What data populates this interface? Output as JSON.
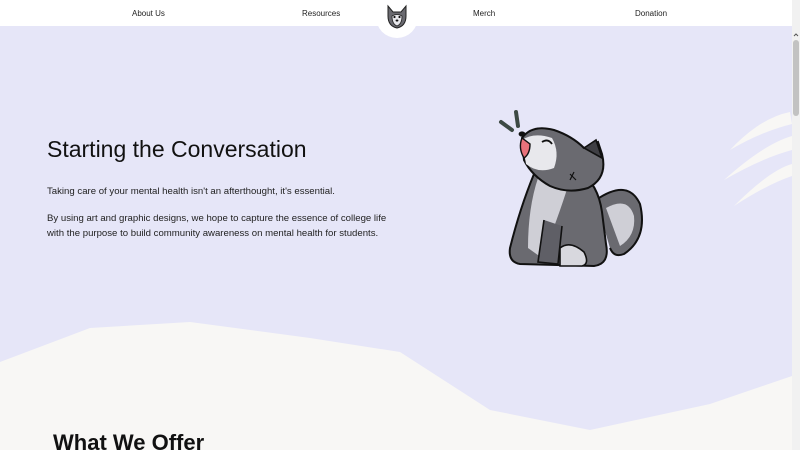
{
  "nav": {
    "items": [
      {
        "label": "About Us"
      },
      {
        "label": "Resources"
      },
      {
        "label": "Merch"
      },
      {
        "label": "Donation"
      }
    ],
    "logo_icon": "husky-logo-icon"
  },
  "hero": {
    "title": "Starting the Conversation",
    "paragraph_1": "Taking care of your mental health isn't an afterthought, it's essential.",
    "paragraph_2": "By using art and graphic designs, we hope to capture the essence of college life with the purpose to build community awareness on mental health for students.",
    "illustration": "howling-husky-icon",
    "decoration": "claw-marks-icon"
  },
  "section": {
    "title": "What We Offer"
  },
  "colors": {
    "hero_bg": "#e6e6f8",
    "ground": "#f8f7f5",
    "nav_bg": "#ffffff",
    "husky_dark": "#5f5f66",
    "husky_light": "#cfcfd6",
    "accent_mouth": "#e9727a"
  }
}
